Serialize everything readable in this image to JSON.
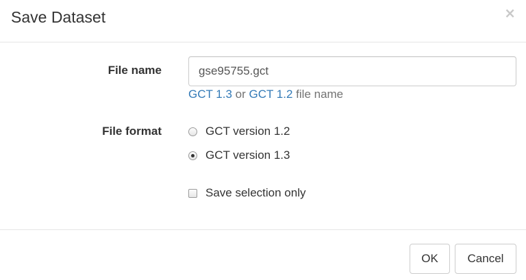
{
  "dialog": {
    "title": "Save Dataset",
    "close_label": "×"
  },
  "form": {
    "file_name": {
      "label": "File name",
      "value": "gse95755.gct",
      "help": {
        "link1": "GCT 1.3",
        "or_text": " or ",
        "link2": "GCT 1.2",
        "suffix": " file name"
      }
    },
    "file_format": {
      "label": "File format",
      "options": [
        {
          "label": "GCT version 1.2",
          "checked": false
        },
        {
          "label": "GCT version 1.3",
          "checked": true
        }
      ]
    },
    "save_selection": {
      "label": "Save selection only",
      "checked": false
    }
  },
  "footer": {
    "ok_label": "OK",
    "cancel_label": "Cancel"
  }
}
